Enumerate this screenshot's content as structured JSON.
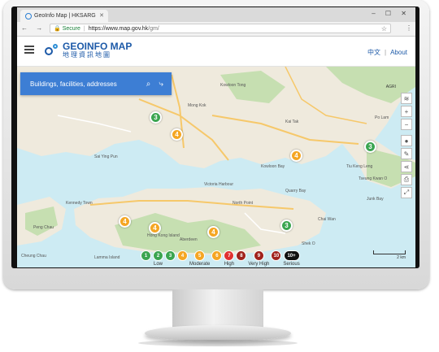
{
  "browser": {
    "tab_title": "GeoInfo Map | HKSARG",
    "nav_buttons": "← → C",
    "secure_label": "Secure",
    "url_host": "https://www.map.gov.hk",
    "url_path": "/gm/",
    "window_controls": "– ☐ ✕"
  },
  "header": {
    "logo_en": "GEOINFO MAP",
    "logo_zh": "地理資訊地圖",
    "lang_zh": "中文",
    "about": "About"
  },
  "search": {
    "placeholder": "Buildings, facilities, addresses"
  },
  "markers": [
    {
      "value": "3",
      "color": "green"
    },
    {
      "value": "4",
      "color": "orange"
    },
    {
      "value": "4",
      "color": "orange"
    },
    {
      "value": "3",
      "color": "green"
    },
    {
      "value": "4",
      "color": "orange"
    },
    {
      "value": "4",
      "color": "orange"
    },
    {
      "value": "4",
      "color": "orange"
    },
    {
      "value": "3",
      "color": "green"
    }
  ],
  "map_labels": [
    "Sai Ying Pun",
    "Kowloon Tong",
    "Kowloon Bay",
    "Victoria Harbour",
    "North Point",
    "Quarry Bay",
    "Aberdeen",
    "Cheung Chau",
    "Tseung Kwan O",
    "Junk Bay",
    "Po Lam",
    "Tiu Keng Leng",
    "Mong Kok",
    "Kai Tak",
    "Hong Kong Island",
    "Peng Chau",
    "Lamma Island",
    "Kennedy Town",
    "Chai Wan",
    "Shek O"
  ],
  "map_corner_label": "AGRI",
  "legend": [
    {
      "value": "1",
      "color": "#3ba550",
      "caption": ""
    },
    {
      "value": "2",
      "color": "#3ba550",
      "caption": "Low"
    },
    {
      "value": "3",
      "color": "#3ba550",
      "caption": ""
    },
    {
      "value": "4",
      "color": "#f5a623",
      "caption": ""
    },
    {
      "value": "5",
      "color": "#f5a623",
      "caption": "Moderate"
    },
    {
      "value": "6",
      "color": "#f5a623",
      "caption": ""
    },
    {
      "value": "7",
      "color": "#e03131",
      "caption": "High"
    },
    {
      "value": "8",
      "color": "#a0231e",
      "caption": ""
    },
    {
      "value": "9",
      "color": "#a0231e",
      "caption": "Very High"
    },
    {
      "value": "10",
      "color": "#a0231e",
      "caption": ""
    },
    {
      "value": "10+",
      "color": "#111111",
      "caption": "Serious"
    }
  ],
  "scale_label": "2 km",
  "colors": {
    "brand": "#1d5aa8",
    "search_bg": "#3d7ed4",
    "water": "#cdebf3",
    "land": "#efeadd",
    "green_area": "#c6dfb1"
  }
}
